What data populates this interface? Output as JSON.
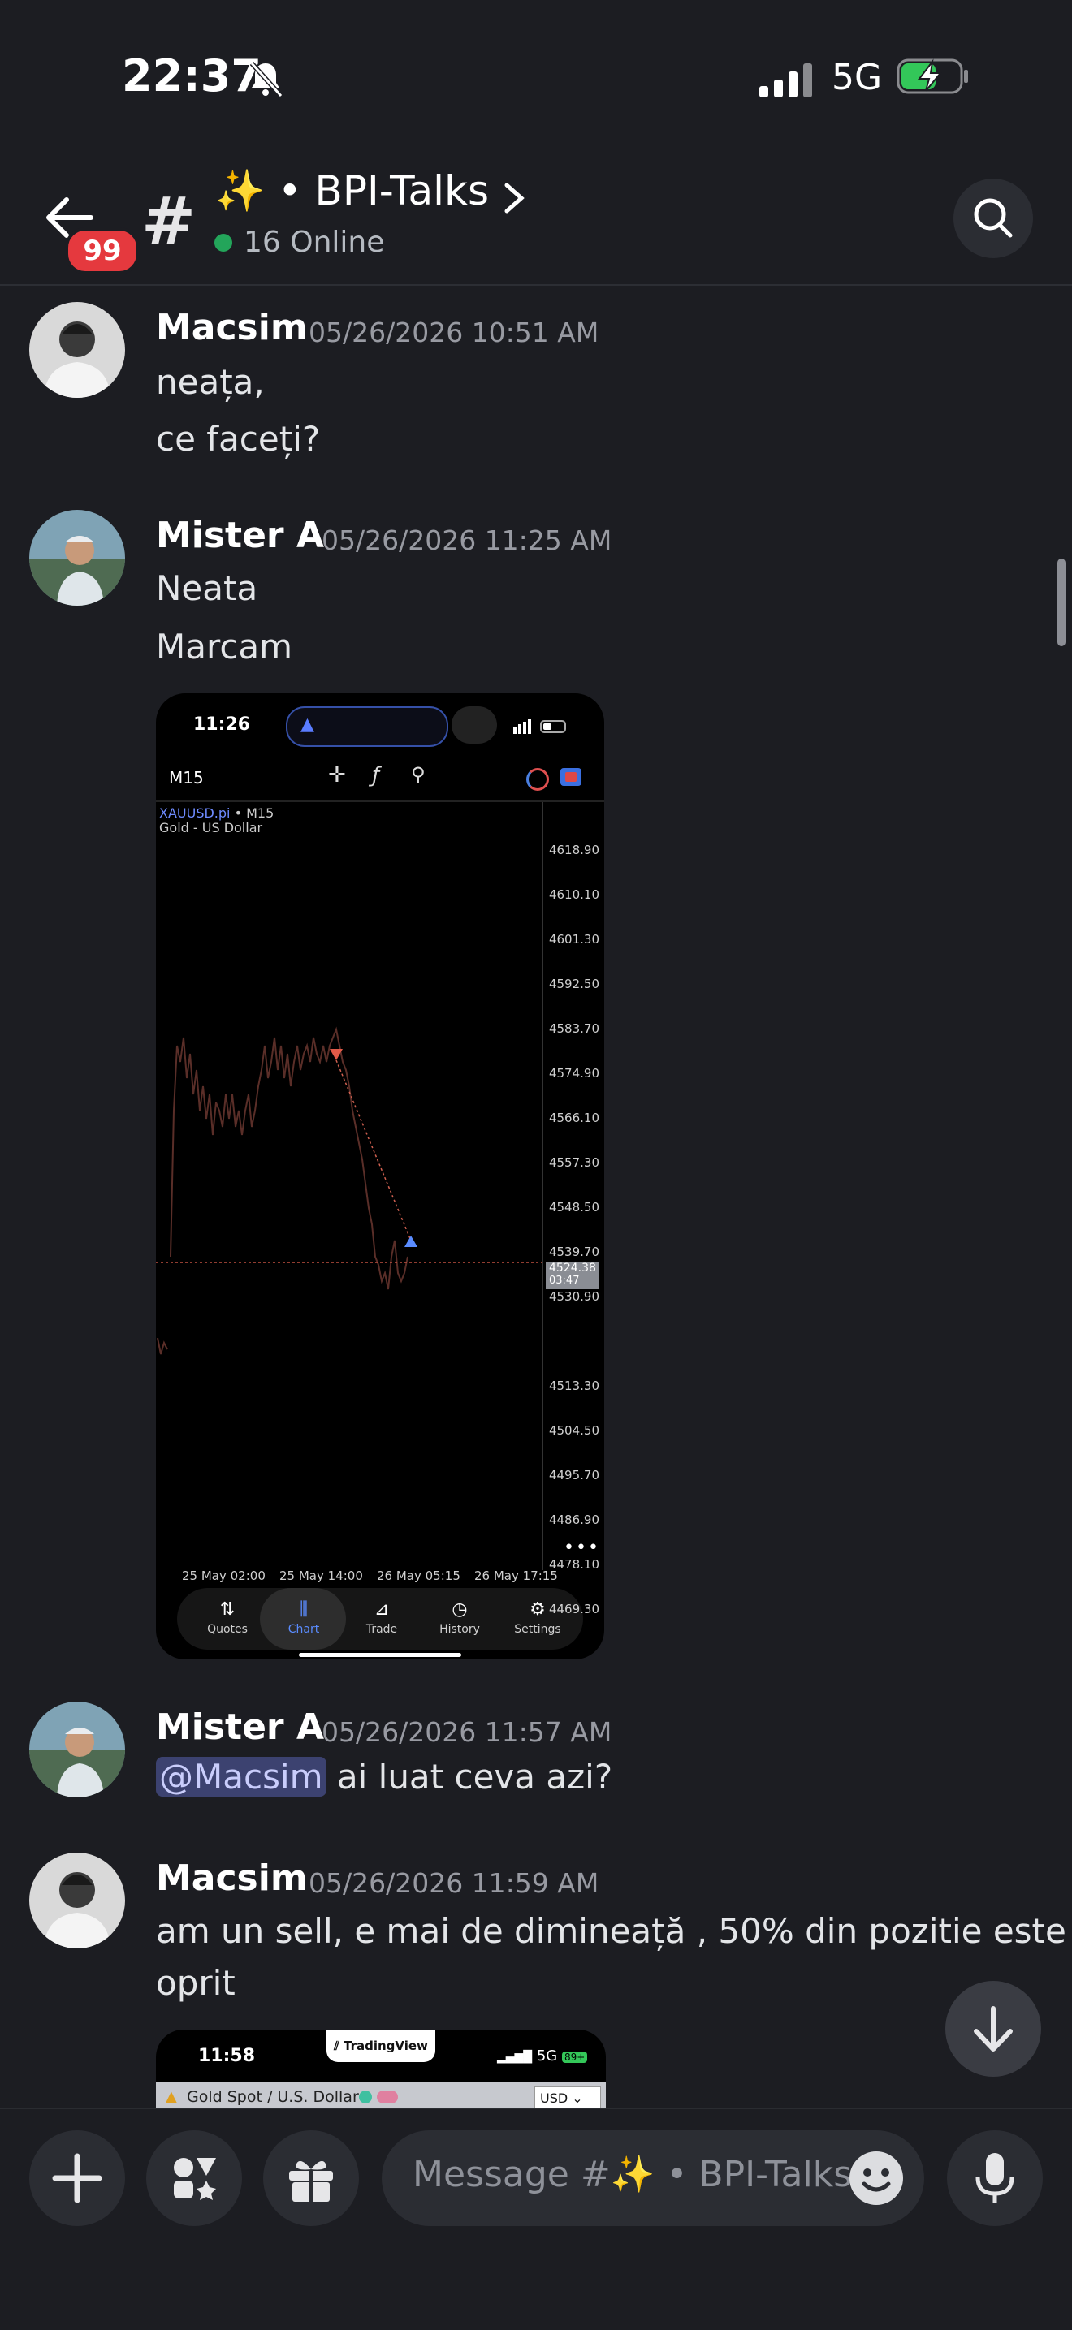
{
  "status_bar": {
    "time": "22:37",
    "network": "5G"
  },
  "header": {
    "unread_badge": "99",
    "channel_name": "✨ • BPI-Talks",
    "online": "16 Online"
  },
  "messages": [
    {
      "author": "Macsim",
      "timestamp": "05/26/2026 10:51 AM",
      "lines": [
        "neața,",
        "ce faceți?"
      ]
    },
    {
      "author": "Mister A",
      "timestamp": "05/26/2026 11:25 AM",
      "lines": [
        "Neata",
        "Marcam"
      ]
    },
    {
      "author": "Mister A",
      "timestamp": "05/26/2026 11:57 AM",
      "mention": "@Macsim",
      "text": "ai luat ceva azi?"
    },
    {
      "author": "Macsim",
      "timestamp": "05/26/2026 11:59 AM",
      "lines": [
        "am un sell, e mai de dimineață , 50% din pozitie este",
        "oprit"
      ]
    }
  ],
  "attachment_1": {
    "time": "11:26",
    "timeframe": "M15",
    "symbol": "XAUUSD.pi",
    "symbol_tf": "• M15",
    "description": "Gold - US Dollar",
    "prices": [
      "4618.90",
      "4610.10",
      "4601.30",
      "4592.50",
      "4583.70",
      "4574.90",
      "4566.10",
      "4557.30",
      "4548.50",
      "4539.70",
      "4530.90",
      "4524.38",
      "4513.30",
      "4504.50",
      "4495.70",
      "4486.90",
      "4478.10",
      "4469.30"
    ],
    "current_price": "4524.38",
    "countdown": "03:47",
    "dates": [
      "25 May 02:00",
      "25 May 14:00",
      "26 May 05:15",
      "26 May 17:15"
    ],
    "tabs": [
      "Quotes",
      "Chart",
      "Trade",
      "History",
      "Settings"
    ]
  },
  "attachment_2": {
    "time": "11:58",
    "brand": "TradingView",
    "network": "5G",
    "battery": "89+",
    "title": "Gold Spot / U.S. Dollar",
    "currency": "USD"
  },
  "composer": {
    "placeholder": "Message #✨ • BPI-Talks"
  }
}
